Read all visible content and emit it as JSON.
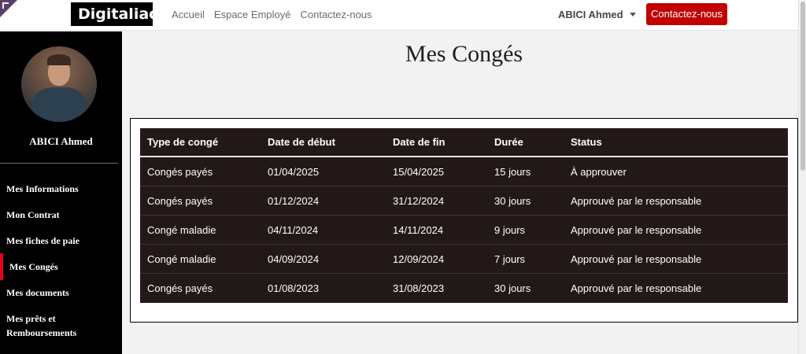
{
  "header": {
    "logo_text": "Digitaliac",
    "nav": [
      "Accueil",
      "Espace Employé",
      "Contactez-nous"
    ],
    "user_name": "ABICI Ahmed",
    "cta_label": "Contactez-nous"
  },
  "sidebar": {
    "user_name": "ABICI Ahmed",
    "items": [
      {
        "label": "Mes Informations"
      },
      {
        "label": "Mon Contrat"
      },
      {
        "label": "Mes fiches de paie"
      },
      {
        "label": "Mes Congés"
      },
      {
        "label": "Mes documents"
      },
      {
        "label": "Mes prêts et Remboursements"
      }
    ],
    "active_index": 3
  },
  "page": {
    "title": "Mes Congés"
  },
  "table": {
    "headers": [
      "Type de congé",
      "Date de début",
      "Date de fin",
      "Durée",
      "Status"
    ],
    "rows": [
      [
        "Congés payés",
        "01/04/2025",
        "15/04/2025",
        "15 jours",
        "À approuver"
      ],
      [
        "Congés payés",
        "01/12/2024",
        "31/12/2024",
        "30 jours",
        "Approuvé par le responsable"
      ],
      [
        "Congé maladie",
        "04/11/2024",
        "14/11/2024",
        "9 jours",
        "Approuvé par le responsable"
      ],
      [
        "Congé maladie",
        "04/09/2024",
        "12/09/2024",
        "7 jours",
        "Approuvé par le responsable"
      ],
      [
        "Congés payés",
        "01/08/2023",
        "31/08/2023",
        "30 jours",
        "Approuvé par le responsable"
      ]
    ]
  },
  "colors": {
    "accent": "#c10000",
    "sidebar_bg": "#000000",
    "table_bg": "#231818"
  }
}
